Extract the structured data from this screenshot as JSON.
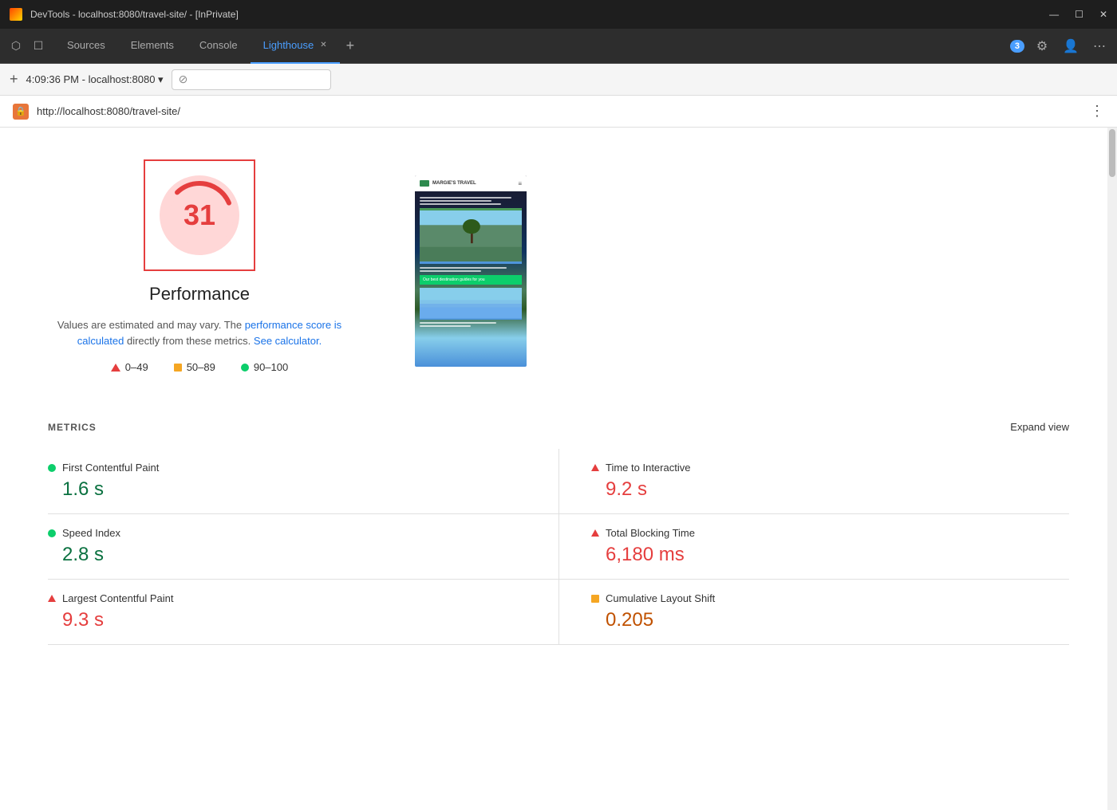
{
  "titleBar": {
    "title": "DevTools - localhost:8080/travel-site/ - [InPrivate]",
    "icon": "devtools-icon",
    "controls": {
      "minimize": "—",
      "maximize": "☐",
      "close": "✕"
    }
  },
  "tabBar": {
    "tabs": [
      {
        "label": "Sources",
        "active": false
      },
      {
        "label": "Elements",
        "active": false
      },
      {
        "label": "Console",
        "active": false
      },
      {
        "label": "Lighthouse",
        "active": true,
        "closeable": true
      }
    ],
    "addTab": "+",
    "notification": "3",
    "icons": {
      "settings": "⚙",
      "profile": "👤",
      "more": "⋯"
    }
  },
  "addressBar": {
    "add": "+",
    "time": "4:09:36 PM",
    "url": "localhost:8080",
    "urlDropdown": "▾",
    "cancel": "⊘"
  },
  "pageUrlBar": {
    "url": "http://localhost:8080/travel-site/",
    "menu": "⋮"
  },
  "performance": {
    "score": "31",
    "title": "Performance",
    "description": "Values are estimated and may vary. The",
    "link1": "performance score is calculated",
    "description2": "directly from these metrics.",
    "link2": "See calculator.",
    "legend": {
      "bad": "0–49",
      "medium": "50–89",
      "good": "90–100"
    }
  },
  "metrics": {
    "title": "METRICS",
    "expandLabel": "Expand view",
    "items": [
      {
        "name": "First Contentful Paint",
        "value": "1.6 s",
        "status": "good"
      },
      {
        "name": "Time to Interactive",
        "value": "9.2 s",
        "status": "bad"
      },
      {
        "name": "Speed Index",
        "value": "2.8 s",
        "status": "good"
      },
      {
        "name": "Total Blocking Time",
        "value": "6,180 ms",
        "status": "bad"
      },
      {
        "name": "Largest Contentful Paint",
        "value": "9.3 s",
        "status": "bad"
      },
      {
        "name": "Cumulative Layout Shift",
        "value": "0.205",
        "status": "medium"
      }
    ]
  }
}
